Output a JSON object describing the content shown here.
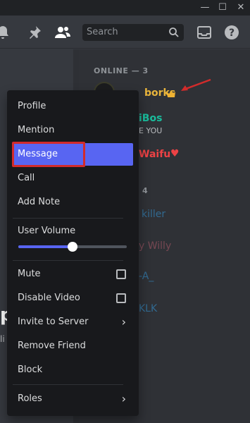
{
  "toolbar": {
    "search_placeholder": "Search"
  },
  "members": {
    "online_header": "ONLINE — 3",
    "first_name": "borks",
    "second_name": "iBos",
    "second_status": "E YOU",
    "third_name": "Waifu",
    "offline_count": "4",
    "faded": [
      "killer",
      "y Willy",
      "-A_",
      "KLK"
    ],
    "colors": {
      "first": "#e9b53c",
      "second": "#1abc9c",
      "third": "#ed4245",
      "faded1": "#3498db",
      "faded2": "#b05a6a",
      "faded3": "#3498db",
      "faded4": "#3498db"
    }
  },
  "left_partial": {
    "big": "p",
    "small": "li"
  },
  "context_menu": {
    "items": {
      "profile": "Profile",
      "mention": "Mention",
      "message": "Message",
      "call": "Call",
      "add_note": "Add Note",
      "user_volume": "User Volume",
      "mute": "Mute",
      "disable_video": "Disable Video",
      "invite": "Invite to Server",
      "remove_friend": "Remove Friend",
      "block": "Block",
      "roles": "Roles"
    },
    "volume_fraction": 0.5,
    "accent_color": "#5865f2",
    "highlight_color": "#d22b2b"
  },
  "icons": {
    "titlebar": [
      "minimize-icon",
      "maximize-icon",
      "close-icon"
    ],
    "toolbar": [
      "bell-icon",
      "pin-icon",
      "members-icon",
      "inbox-icon",
      "help-icon"
    ]
  }
}
